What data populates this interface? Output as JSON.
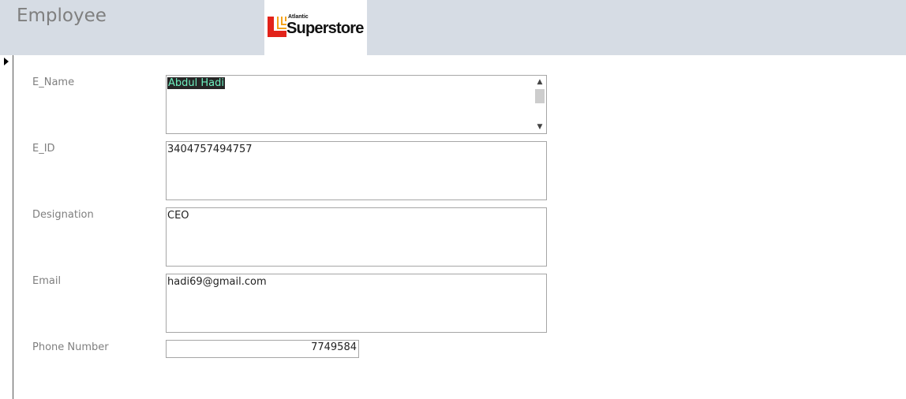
{
  "header": {
    "title": "Employee"
  },
  "logo": {
    "small": "Atlantic",
    "big": "Superstore"
  },
  "fields": [
    {
      "label": "E_Name",
      "value": "Abdul Hadi"
    },
    {
      "label": "E_ID",
      "value": "3404757494757"
    },
    {
      "label": "Designation",
      "value": "CEO"
    },
    {
      "label": "Email",
      "value": "hadi69@gmail.com"
    },
    {
      "label": "Phone Number",
      "value": "7749584"
    }
  ],
  "colors": {
    "header_bg": "#d6dce4",
    "label": "#7f7f7f",
    "logo_red": "#e2231a",
    "logo_orange": "#f5a31a"
  }
}
